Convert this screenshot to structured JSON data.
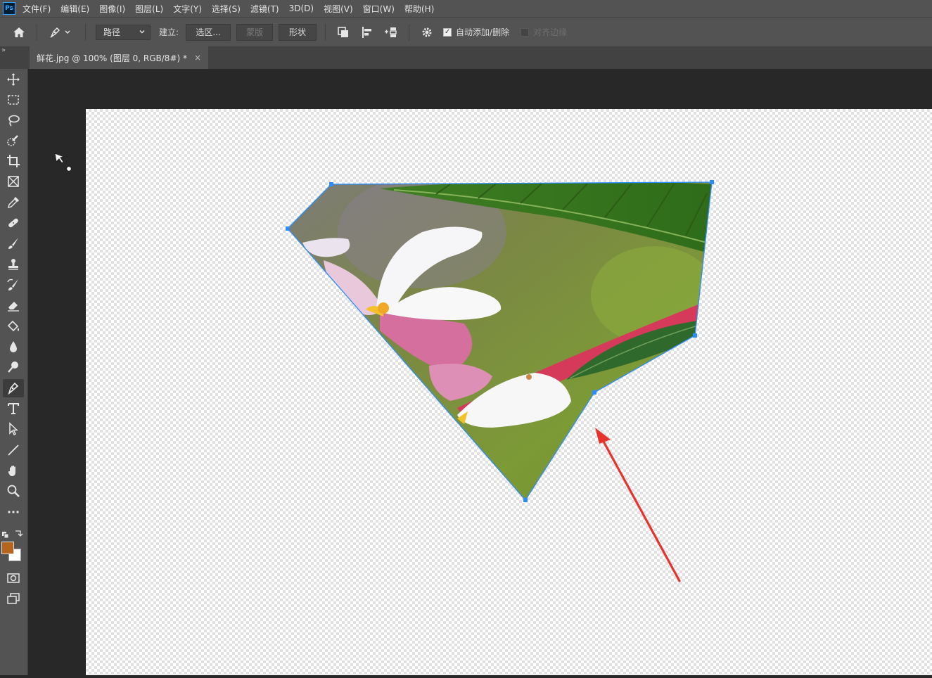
{
  "app": {
    "logo": "Ps"
  },
  "menu": {
    "items": [
      "文件(F)",
      "编辑(E)",
      "图像(I)",
      "图层(L)",
      "文字(Y)",
      "选择(S)",
      "滤镜(T)",
      "3D(D)",
      "视图(V)",
      "窗口(W)",
      "帮助(H)"
    ]
  },
  "options": {
    "mode_value": "路径",
    "make_label": "建立:",
    "selection_button": "选区...",
    "mask_button": "蒙版",
    "shape_button": "形状",
    "auto_add_delete_label": "自动添加/删除",
    "auto_add_delete_checked": true,
    "align_edges_label": "对齐边缘",
    "align_edges_checked": false
  },
  "document": {
    "tab_title": "鲜花.jpg @ 100% (图层 0, RGB/8#) *",
    "close_glyph": "×",
    "panel_collapse_glyph": "»"
  },
  "toolbar": {
    "tools": [
      "move-tool-icon",
      "marquee-tool-icon",
      "lasso-tool-icon",
      "quick-select-tool-icon",
      "crop-tool-icon",
      "frame-tool-icon",
      "eyedropper-tool-icon",
      "healing-brush-icon",
      "brush-tool-icon",
      "clone-stamp-icon",
      "history-brush-icon",
      "eraser-tool-icon",
      "paint-bucket-icon",
      "blur-tool-icon",
      "dodge-tool-icon",
      "pen-tool-icon",
      "type-tool-icon",
      "path-select-icon",
      "line-tool-icon",
      "hand-tool-icon",
      "zoom-tool-icon",
      "more-tools-icon"
    ],
    "active_tool": "pen-tool-icon",
    "foreground_color": "#b5651d",
    "background_color": "#ffffff"
  },
  "canvas": {
    "content": "flower image clipped by pen path",
    "path_color": "#2a8cff",
    "annotation_arrow_color": "#e8322c"
  }
}
